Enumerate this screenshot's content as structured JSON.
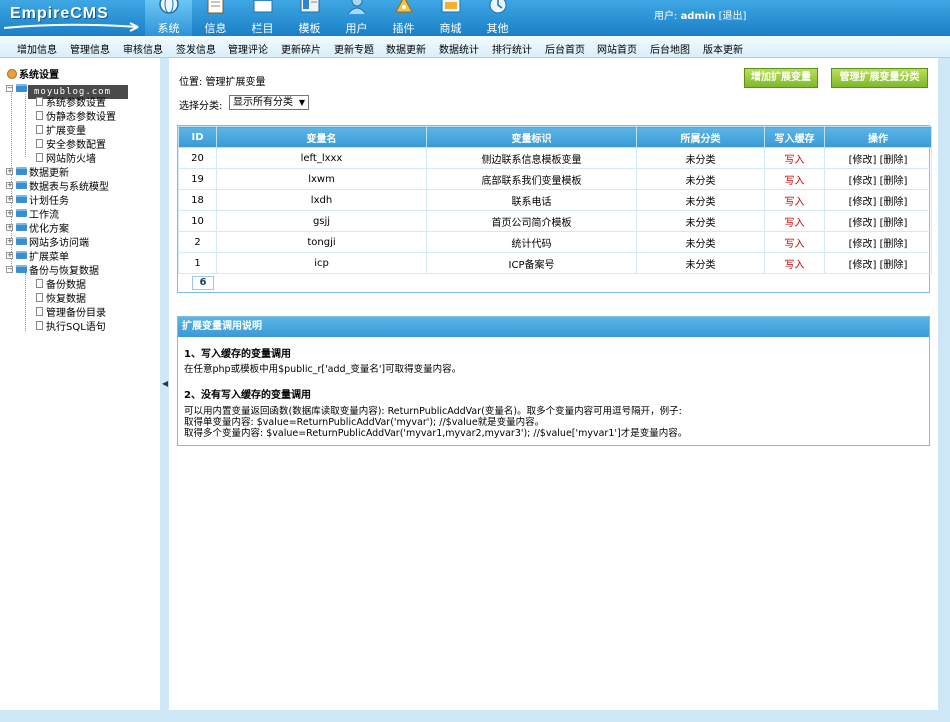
{
  "header": {
    "logo_text": "EmpireCMS",
    "nav": [
      {
        "label": "系统",
        "icon": "globe-icon",
        "active": true
      },
      {
        "label": "信息",
        "icon": "notepad-icon"
      },
      {
        "label": "栏目",
        "icon": "window-icon"
      },
      {
        "label": "模板",
        "icon": "template-icon"
      },
      {
        "label": "用户",
        "icon": "user-icon"
      },
      {
        "label": "插件",
        "icon": "plugin-icon"
      },
      {
        "label": "商城",
        "icon": "shop-icon"
      },
      {
        "label": "其他",
        "icon": "other-icon"
      }
    ],
    "user_label": "用户:",
    "username": "admin",
    "logout": "[退出]"
  },
  "submenu": [
    "增加信息",
    "管理信息",
    "审核信息",
    "签发信息",
    "管理评论",
    "更新碎片",
    "更新专题",
    "数据更新",
    "数据统计",
    "排行统计",
    "后台首页",
    "网站首页",
    "后台地图",
    "版本更新"
  ],
  "sidebar": {
    "root": "系统设置",
    "watermark": "moyublog.com",
    "items": [
      {
        "label": "系统参数设置",
        "level": 2
      },
      {
        "label": "伪静态参数设置",
        "level": 2
      },
      {
        "label": "扩展变量",
        "level": 2
      },
      {
        "label": "安全参数配置",
        "level": 2
      },
      {
        "label": "网站防火墙",
        "level": 2
      },
      {
        "label": "数据更新",
        "level": 1
      },
      {
        "label": "数据表与系统模型",
        "level": 1
      },
      {
        "label": "计划任务",
        "level": 1
      },
      {
        "label": "工作流",
        "level": 1
      },
      {
        "label": "优化方案",
        "level": 1
      },
      {
        "label": "网站多访问端",
        "level": 1
      },
      {
        "label": "扩展菜单",
        "level": 1
      },
      {
        "label": "备份与恢复数据",
        "level": 1,
        "open": true
      },
      {
        "label": "备份数据",
        "level": 2
      },
      {
        "label": "恢复数据",
        "level": 2
      },
      {
        "label": "管理备份目录",
        "level": 2
      },
      {
        "label": "执行SQL语句",
        "level": 2
      }
    ]
  },
  "main": {
    "position": "位置: 管理扩展变量",
    "btn_add": "增加扩展变量",
    "btn_manage_class": "管理扩展变量分类",
    "filter_label": "选择分类:",
    "filter_value": "显示所有分类",
    "table": {
      "headers": [
        "ID",
        "变量名",
        "变量标识",
        "所属分类",
        "写入缓存",
        "操作"
      ],
      "rows": [
        {
          "id": "20",
          "name": "left_lxxx",
          "label": "侧边联系信息模板变量",
          "class": "未分类",
          "cache": "写入",
          "ops": "[修改] [删除]"
        },
        {
          "id": "19",
          "name": "lxwm",
          "label": "底部联系我们变量模板",
          "class": "未分类",
          "cache": "写入",
          "ops": "[修改] [删除]"
        },
        {
          "id": "18",
          "name": "lxdh",
          "label": "联系电话",
          "class": "未分类",
          "cache": "写入",
          "ops": "[修改] [删除]"
        },
        {
          "id": "10",
          "name": "gsjj",
          "label": "首页公司简介模板",
          "class": "未分类",
          "cache": "写入",
          "ops": "[修改] [删除]"
        },
        {
          "id": "2",
          "name": "tongji",
          "label": "统计代码",
          "class": "未分类",
          "cache": "写入",
          "ops": "[修改] [删除]"
        },
        {
          "id": "1",
          "name": "icp",
          "label": "ICP备案号",
          "class": "未分类",
          "cache": "写入",
          "ops": "[修改] [删除]"
        }
      ],
      "page": "6"
    },
    "help": {
      "title": "扩展变量调用说明",
      "h1": "1、写入缓存的变量调用",
      "p1": "在任意php或模板中用$public_r['add_变量名']可取得变量内容。",
      "h2": "2、没有写入缓存的变量调用",
      "p2": "可以用内置变量返回函数(数据库读取变量内容): ReturnPublicAddVar(变量名)。取多个变量内容可用逗号隔开，例子:",
      "p3": "取得单变量内容: $value=ReturnPublicAddVar('myvar'); //$value就是变量内容。",
      "p4": "取得多个变量内容: $value=ReturnPublicAddVar('myvar1,myvar2,myvar3'); //$value['myvar1']才是变量内容。"
    }
  }
}
